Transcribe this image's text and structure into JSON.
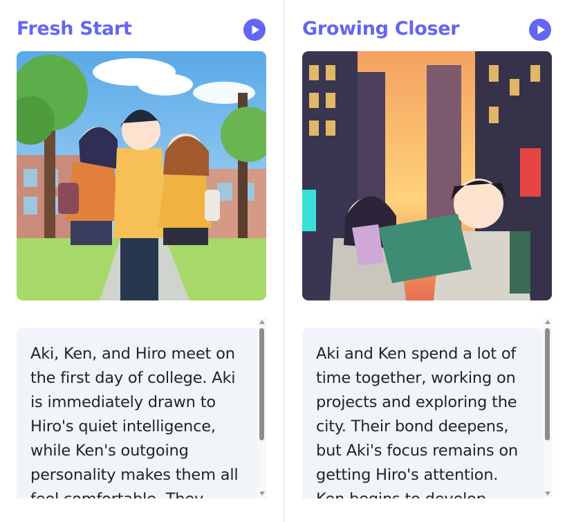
{
  "colors": {
    "accent": "#6366f1",
    "text_bg": "#f1f4f8",
    "text": "#1f2328"
  },
  "cards": [
    {
      "title": "Fresh Start",
      "play_icon": "play-circle-icon",
      "image_alt": "Three anime students standing together on a sunny college campus",
      "story": "Aki, Ken, and Hiro meet on the first day of college. Aki is immediately drawn to Hiro's quiet intelligence, while Ken's outgoing personality makes them all feel comfortable. They"
    },
    {
      "title": "Growing Closer",
      "play_icon": "play-circle-icon",
      "image_alt": "Two anime characters looking at a tablet on a neon city street at sunset",
      "story": "Aki and Ken spend a lot of time together, working on projects and exploring the city. Their bond deepens, but Aki's focus remains on getting Hiro's attention. Ken begins to develop"
    }
  ]
}
